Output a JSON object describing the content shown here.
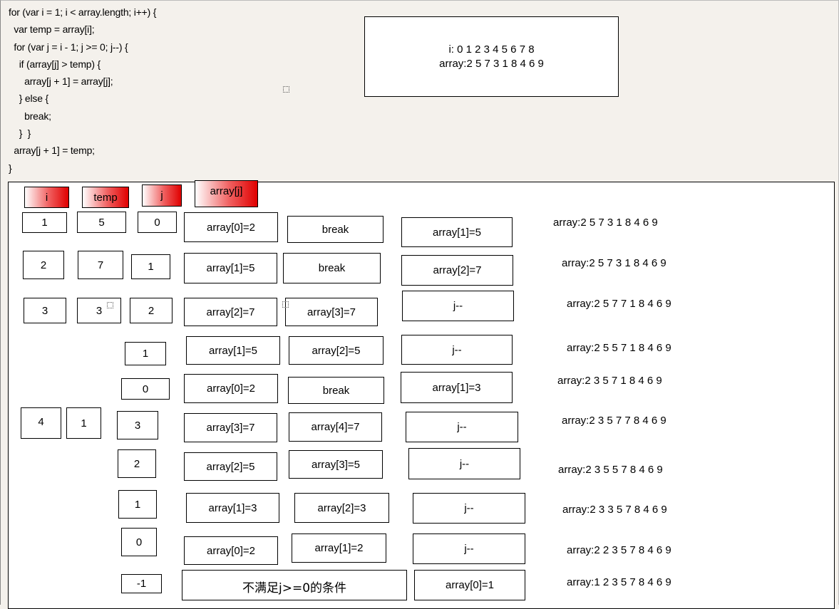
{
  "code": "for (var i = 1; i < array.length; i++) {\n  var temp = array[i];\n  for (var j = i - 1; j >= 0; j--) {\n    if (array[j] > temp) {\n      array[j + 1] = array[j];\n    } else {\n      break;\n    }  }\n  array[j + 1] = temp;\n}",
  "info": {
    "i_line": "i:  0 1 2 3 4 5 6 7 8",
    "array_line": "array:2 5 7 3 1 8 4 6 9"
  },
  "headers": {
    "i": "i",
    "temp": "temp",
    "j": "j",
    "arrayj": "array[j]"
  },
  "rows": {
    "r1": {
      "i": "1",
      "temp": "5",
      "j": "0",
      "a": "array[0]=2",
      "b": "break",
      "c": "array[1]=5",
      "state": "array:2 5 7 3 1 8 4 6 9"
    },
    "r2": {
      "i": "2",
      "temp": "7",
      "j": "1",
      "a": "array[1]=5",
      "b": "break",
      "c": "array[2]=7",
      "state": "array:2 5 7 3 1 8 4 6 9"
    },
    "r3": {
      "i": "3",
      "temp": "3",
      "j": "2",
      "a": "array[2]=7",
      "b": "array[3]=7",
      "c": "j--",
      "state": "array:2 5 7 7 1 8 4 6 9"
    },
    "r4": {
      "j": "1",
      "a": "array[1]=5",
      "b": "array[2]=5",
      "c": "j--",
      "state": "array:2 5 5 7 1 8 4 6 9"
    },
    "r5": {
      "j": "0",
      "a": "array[0]=2",
      "b": "break",
      "c": "array[1]=3",
      "state": "array:2 3 5 7 1 8 4 6 9"
    },
    "r6": {
      "i": "4",
      "temp": "1",
      "j": "3",
      "a": "array[3]=7",
      "b": "array[4]=7",
      "c": "j--",
      "state": "array:2 3 5 7 7 8 4 6 9"
    },
    "r7": {
      "j": "2",
      "a": "array[2]=5",
      "b": "array[3]=5",
      "c": "j--",
      "state": "array:2 3 5 5 7 8 4 6 9"
    },
    "r8": {
      "j": "1",
      "a": "array[1]=3",
      "b": "array[2]=3",
      "c": "j--",
      "state": "array:2 3 3 5 7 8 4 6 9"
    },
    "r9": {
      "j": "0",
      "a": "array[0]=2",
      "b": "array[1]=2",
      "c": "j--",
      "state": "array:2 2 3 5 7 8 4 6 9"
    },
    "r10": {
      "j": "-1",
      "note": "不满足j>=0的条件",
      "c": "array[0]=1",
      "state": "array:1 2 3 5 7 8 4 6 9"
    }
  }
}
